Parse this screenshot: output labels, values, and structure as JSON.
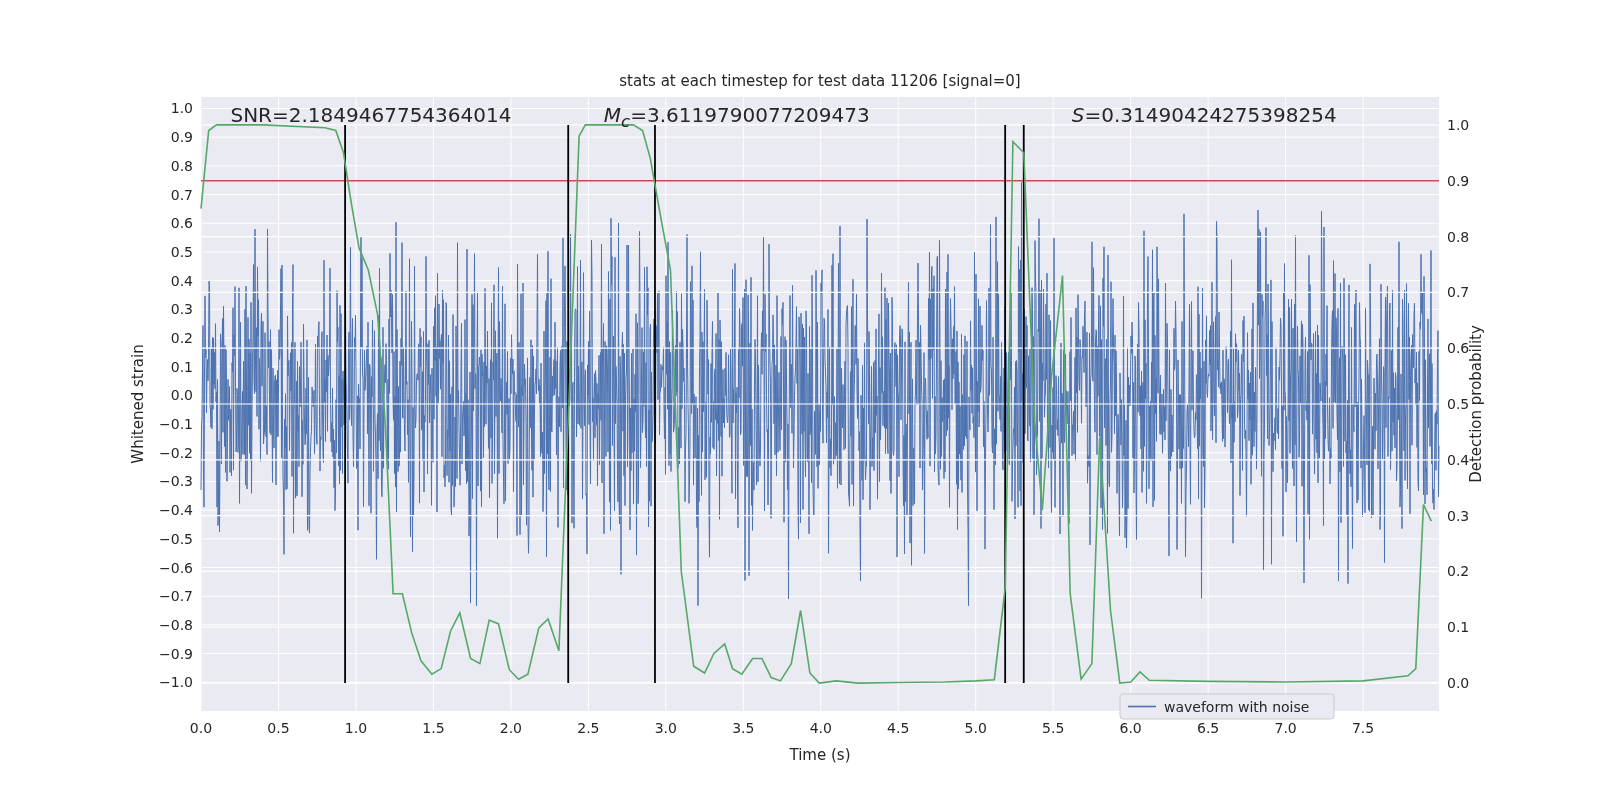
{
  "figure": {
    "title": "stats at each timestep for test data 11206 [signal=0]",
    "strain_axis": {
      "label": "Whitened strain",
      "ticks": [
        "1.0",
        "0.9",
        "0.8",
        "0.7",
        "0.6",
        "0.5",
        "0.4",
        "0.3",
        "0.2",
        "0.1",
        "0.0",
        "−0.1",
        "−0.2",
        "−0.3",
        "−0.4",
        "−0.5",
        "−0.6",
        "−0.7",
        "−0.8",
        "−0.9",
        "−1.0"
      ]
    },
    "chart_data": {
      "type": "line",
      "xlabel": "Time (s)",
      "ylabel": "Detection probability",
      "xlim": [
        0,
        7.99
      ],
      "ylim": [
        -0.05,
        1.05
      ],
      "grid": true,
      "xticks": [
        {
          "value": 0,
          "label": "0.0"
        },
        {
          "value": 0.5,
          "label": "0.5"
        },
        {
          "value": 1,
          "label": "1.0"
        },
        {
          "value": 1.5,
          "label": "1.5"
        },
        {
          "value": 2,
          "label": "2.0"
        },
        {
          "value": 2.5,
          "label": "2.5"
        },
        {
          "value": 3,
          "label": "3.0"
        },
        {
          "value": 3.5,
          "label": "3.5"
        },
        {
          "value": 4,
          "label": "4.0"
        },
        {
          "value": 4.5,
          "label": "4.5"
        },
        {
          "value": 5,
          "label": "5.0"
        },
        {
          "value": 5.5,
          "label": "5.5"
        },
        {
          "value": 6,
          "label": "6.0"
        },
        {
          "value": 6.5,
          "label": "6.5"
        },
        {
          "value": 7,
          "label": "7.0"
        },
        {
          "value": 7.5,
          "label": "7.5"
        }
      ],
      "yticks": [
        {
          "value": 0,
          "label": "0.0"
        },
        {
          "value": 0.1,
          "label": "0.1"
        },
        {
          "value": 0.2,
          "label": "0.2"
        },
        {
          "value": 0.3,
          "label": "0.3"
        },
        {
          "value": 0.4,
          "label": "0.4"
        },
        {
          "value": 0.5,
          "label": "0.5"
        },
        {
          "value": 0.6,
          "label": "0.6"
        },
        {
          "value": 0.7,
          "label": "0.7"
        },
        {
          "value": 0.8,
          "label": "0.8"
        },
        {
          "value": 0.9,
          "label": "0.9"
        },
        {
          "value": 1,
          "label": "1.0"
        }
      ],
      "x": [
        0,
        0.05,
        0.1,
        0.4,
        0.8,
        0.87,
        0.92,
        0.97,
        1.02,
        1.08,
        1.14,
        1.19,
        1.24,
        1.3,
        1.36,
        1.42,
        1.49,
        1.55,
        1.61,
        1.67,
        1.74,
        1.8,
        1.86,
        1.92,
        1.99,
        2.05,
        2.11,
        2.18,
        2.24,
        2.31,
        2.36,
        2.44,
        2.48,
        2.79,
        2.85,
        2.9,
        2.97,
        3.03,
        3.1,
        3.18,
        3.25,
        3.31,
        3.38,
        3.43,
        3.49,
        3.56,
        3.62,
        3.68,
        3.74,
        3.81,
        3.87,
        3.93,
        3.99,
        4.1,
        4.24,
        4.5,
        4.8,
        5.0,
        5.12,
        5.19,
        5.24,
        5.31,
        5.38,
        5.43,
        5.49,
        5.56,
        5.61,
        5.68,
        5.75,
        5.8,
        5.87,
        5.93,
        6.0,
        6.06,
        6.12,
        6.5,
        7.0,
        7.5,
        7.79,
        7.84,
        7.89,
        7.94
      ],
      "series": [
        {
          "color": "#55a868",
          "values": [
            0.85,
            0.99,
            1.0,
            1.0,
            0.995,
            0.99,
            0.95,
            0.86,
            0.78,
            0.74,
            0.66,
            0.46,
            0.16,
            0.16,
            0.09,
            0.04,
            0.016,
            0.026,
            0.093,
            0.126,
            0.044,
            0.035,
            0.113,
            0.106,
            0.024,
            0.007,
            0.016,
            0.099,
            0.115,
            0.058,
            0.4,
            0.98,
            1.0,
            1.0,
            0.99,
            0.94,
            0.83,
            0.74,
            0.2,
            0.03,
            0.018,
            0.053,
            0.07,
            0.026,
            0.016,
            0.044,
            0.044,
            0.01,
            0.004,
            0.035,
            0.13,
            0.018,
            0.0,
            0.004,
            0.0,
            0.001,
            0.002,
            0.004,
            0.006,
            0.17,
            0.97,
            0.95,
            0.47,
            0.31,
            0.55,
            0.73,
            0.16,
            0.007,
            0.035,
            0.44,
            0.13,
            0.0,
            0.002,
            0.02,
            0.005,
            0.003,
            0.002,
            0.004,
            0.013,
            0.026,
            0.32,
            0.29
          ]
        }
      ],
      "ref_lines": [
        {
          "axis": "y",
          "value": 0.9,
          "color": "#c44e52"
        },
        {
          "axis": "x",
          "value": 0.93,
          "color": "#000000"
        },
        {
          "axis": "x",
          "value": 2.37,
          "color": "#000000"
        },
        {
          "axis": "x",
          "value": 2.93,
          "color": "#000000"
        },
        {
          "axis": "x",
          "value": 5.19,
          "color": "#000000"
        },
        {
          "axis": "x",
          "value": 5.31,
          "color": "#000000"
        }
      ],
      "annotations": [
        "SNR=2.1849467754364014",
        "*M*$_{c}$=3.6119790077209473",
        "*S*=0.31490424275398254"
      ]
    },
    "legend": [
      {
        "label": "waveform with noise"
      }
    ]
  }
}
